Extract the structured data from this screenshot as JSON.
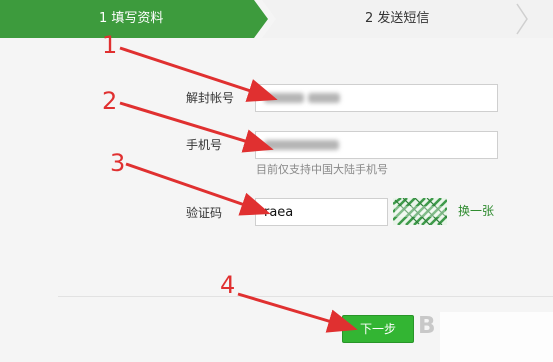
{
  "steps": {
    "step1": "1 填写资料",
    "step2": "2 发送短信"
  },
  "form": {
    "account_label": "解封帐号",
    "account_value": "",
    "phone_label": "手机号",
    "phone_value": "",
    "phone_hint": "目前仅支持中国大陆手机号",
    "captcha_label": "验证码",
    "captcha_value": "raea",
    "captcha_refresh": "换一张"
  },
  "actions": {
    "next_label": "下一步",
    "next_glyph": "B"
  },
  "annotations": {
    "n1": "1",
    "n2": "2",
    "n3": "3",
    "n4": "4"
  },
  "colors": {
    "accent": "#33b533",
    "arrow": "#e03030",
    "link": "#2e8b2e"
  },
  "icons": {
    "captcha": "captcha-image-icon"
  }
}
